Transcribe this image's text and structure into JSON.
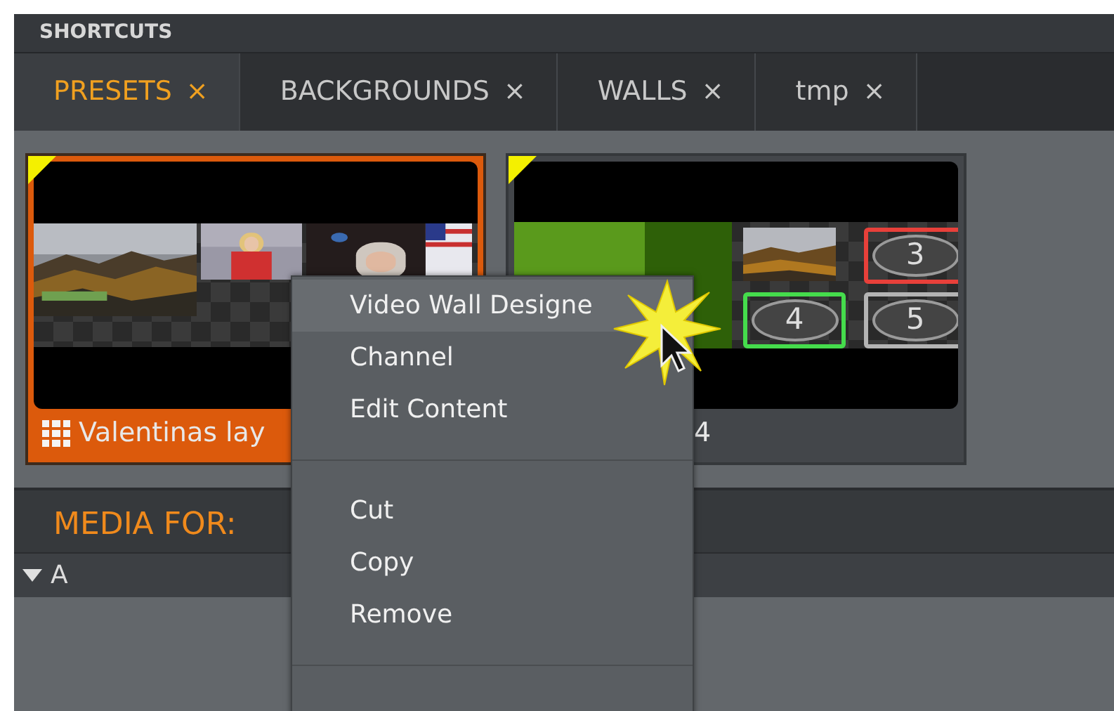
{
  "panel_title": "SHORTCUTS",
  "tabs": [
    {
      "label": "PRESETS",
      "close": "×",
      "selected": true
    },
    {
      "label": "BACKGROUNDS",
      "close": "×",
      "selected": false
    },
    {
      "label": "WALLS",
      "close": "×",
      "selected": false
    },
    {
      "label": "tmp",
      "close": "×",
      "selected": false
    }
  ],
  "presets": [
    {
      "kind": "layout",
      "label": "Valentinas lay",
      "selected": true
    },
    {
      "kind": "wall",
      "label": "4",
      "selected": false,
      "outputs": [
        {
          "label": "3",
          "color": "#e8403a"
        },
        {
          "label": "4",
          "color": "#45dc4c"
        },
        {
          "label": "5",
          "color": "#b4b4b4"
        }
      ]
    }
  ],
  "media_for": "MEDIA FOR:",
  "group": {
    "label": "A",
    "expanded": true
  },
  "context_menu": {
    "items": [
      {
        "kind": "item",
        "label": "Video Wall Designe",
        "selected": true
      },
      {
        "kind": "item",
        "label": "Channel",
        "selected": false
      },
      {
        "kind": "item",
        "label": "Edit Content",
        "selected": false
      },
      {
        "kind": "separator"
      },
      {
        "kind": "item",
        "label": "Cut",
        "selected": false
      },
      {
        "kind": "item",
        "label": "Copy",
        "selected": false
      },
      {
        "kind": "item",
        "label": "Remove",
        "selected": false
      },
      {
        "kind": "separator"
      }
    ]
  }
}
